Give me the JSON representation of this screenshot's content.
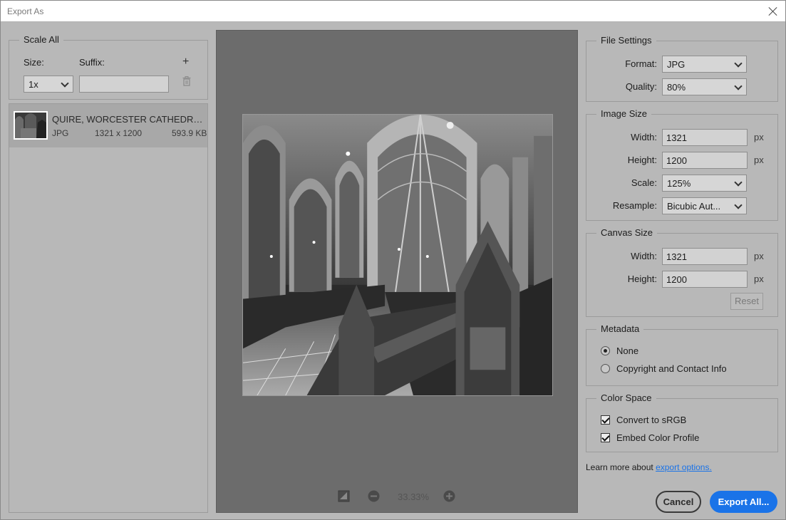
{
  "window": {
    "title": "Export As"
  },
  "scale_all": {
    "title": "Scale All",
    "size_label": "Size:",
    "suffix_label": "Suffix:",
    "size_value": "1x",
    "suffix_value": ""
  },
  "asset": {
    "name": "QUIRE, WORCESTER CATHEDRAL b...",
    "format": "JPG",
    "dimensions": "1321 x 1200",
    "filesize": "593.9 KB"
  },
  "preview": {
    "zoom": "33.33%"
  },
  "file_settings": {
    "title": "File Settings",
    "format_label": "Format:",
    "format_value": "JPG",
    "quality_label": "Quality:",
    "quality_value": "80%"
  },
  "image_size": {
    "title": "Image Size",
    "width_label": "Width:",
    "width_value": "1321",
    "height_label": "Height:",
    "height_value": "1200",
    "unit": "px",
    "scale_label": "Scale:",
    "scale_value": "125%",
    "resample_label": "Resample:",
    "resample_value": "Bicubic Aut..."
  },
  "canvas_size": {
    "title": "Canvas Size",
    "width_label": "Width:",
    "width_value": "1321",
    "height_label": "Height:",
    "height_value": "1200",
    "unit": "px",
    "reset_label": "Reset"
  },
  "metadata": {
    "title": "Metadata",
    "options": [
      "None",
      "Copyright and Contact Info"
    ],
    "selected": "None"
  },
  "color_space": {
    "title": "Color Space",
    "convert_label": "Convert to sRGB",
    "convert_checked": true,
    "embed_label": "Embed Color Profile",
    "embed_checked": true
  },
  "footer": {
    "learn_text": "Learn more about",
    "learn_link": "export options.",
    "cancel_label": "Cancel",
    "export_label": "Export All..."
  },
  "colors": {
    "accent": "#1a73e8",
    "panel_bg": "#b8b8b8",
    "preview_bg": "#6c6c6c"
  },
  "icons": [
    "close-icon",
    "add-icon",
    "trash-icon",
    "toggle-view-icon",
    "zoom-out-icon",
    "zoom-in-icon"
  ]
}
